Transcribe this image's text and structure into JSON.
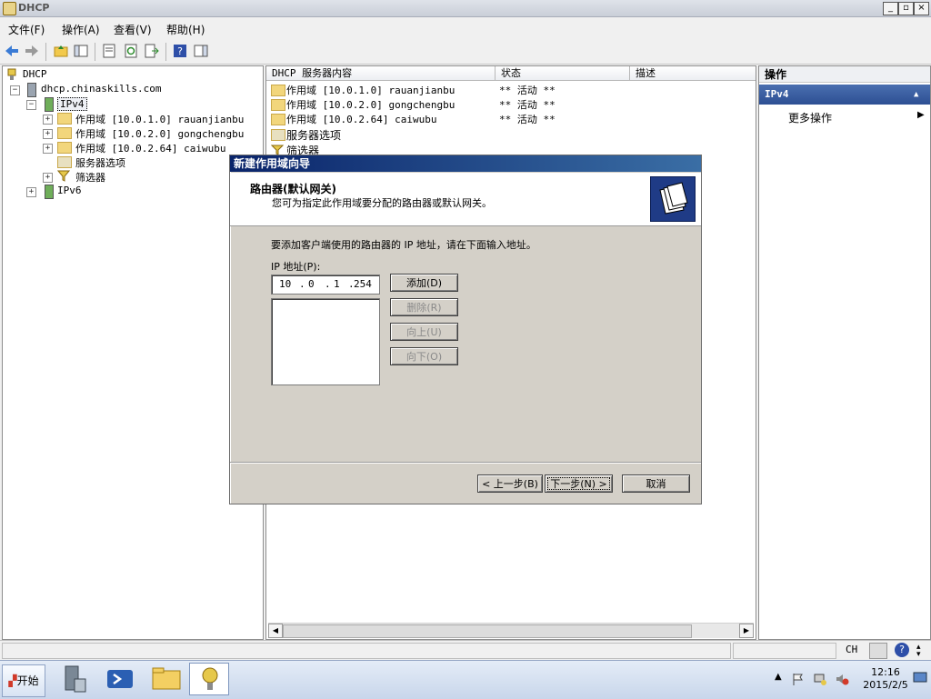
{
  "window": {
    "title": "DHCP"
  },
  "menu": {
    "items": [
      "文件(F)",
      "操作(A)",
      "查看(V)",
      "帮助(H)"
    ]
  },
  "tree": {
    "root": "DHCP",
    "server": "dhcp.chinaskills.com",
    "ipv4": "IPv4",
    "scopes": [
      "作用域 [10.0.1.0] rauanjianbu",
      "作用域 [10.0.2.0] gongchengbu",
      "作用域 [10.0.2.64] caiwubu"
    ],
    "server_options": "服务器选项",
    "filters": "筛选器",
    "ipv6": "IPv6",
    "expander_plus": "+",
    "expander_minus": "−"
  },
  "content": {
    "columns": [
      "DHCP 服务器内容",
      "状态",
      "描述"
    ],
    "rows": [
      {
        "name": "作用域 [10.0.1.0] rauanjianbu",
        "status": "** 活动 **"
      },
      {
        "name": "作用域 [10.0.2.0] gongchengbu",
        "status": "** 活动 **"
      },
      {
        "name": "作用域 [10.0.2.64] caiwubu",
        "status": "** 活动 **"
      },
      {
        "name": "服务器选项",
        "status": ""
      },
      {
        "name": "筛选器",
        "status": ""
      }
    ]
  },
  "actions": {
    "title": "操作",
    "section": "IPv4",
    "more": "更多操作"
  },
  "dialog": {
    "title": "新建作用域向导",
    "heading": "路由器(默认网关)",
    "subheading": "您可为指定此作用域要分配的路由器或默认网关。",
    "instruction": "要添加客户端使用的路由器的 IP 地址，请在下面输入地址。",
    "ip_label": "IP 地址(P):",
    "ip": [
      "10",
      "0",
      "1",
      "254"
    ],
    "buttons": {
      "add": "添加(D)",
      "remove": "删除(R)",
      "up": "向上(U)",
      "down": "向下(O)",
      "back": "< 上一步(B)",
      "next": "下一步(N) >",
      "cancel": "取消"
    }
  },
  "status_bar": {
    "ime": "CH"
  },
  "taskbar": {
    "start": "开始",
    "time": "12:16",
    "date": "2015/2/5"
  }
}
